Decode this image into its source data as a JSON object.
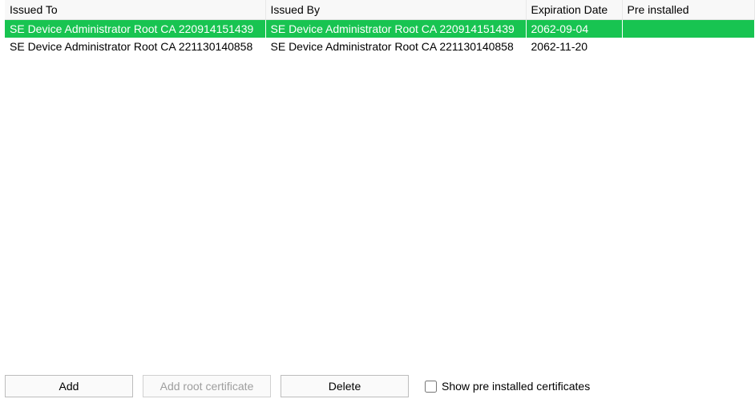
{
  "columns": {
    "issued_to": "Issued To",
    "issued_by": "Issued By",
    "expiration_date": "Expiration Date",
    "pre_installed": "Pre installed"
  },
  "rows": [
    {
      "issued_to": "SE Device Administrator Root CA 220914151439",
      "issued_by": "SE Device Administrator Root CA 220914151439",
      "expiration_date": "2062-09-04",
      "pre_installed": "",
      "selected": true
    },
    {
      "issued_to": "SE Device Administrator Root CA 221130140858",
      "issued_by": "SE Device Administrator Root CA 221130140858",
      "expiration_date": "2062-11-20",
      "pre_installed": "",
      "selected": false
    }
  ],
  "buttons": {
    "add": "Add",
    "add_root": "Add root certificate",
    "delete": "Delete"
  },
  "checkbox": {
    "show_pre_label": "Show pre installed certificates",
    "checked": false
  }
}
